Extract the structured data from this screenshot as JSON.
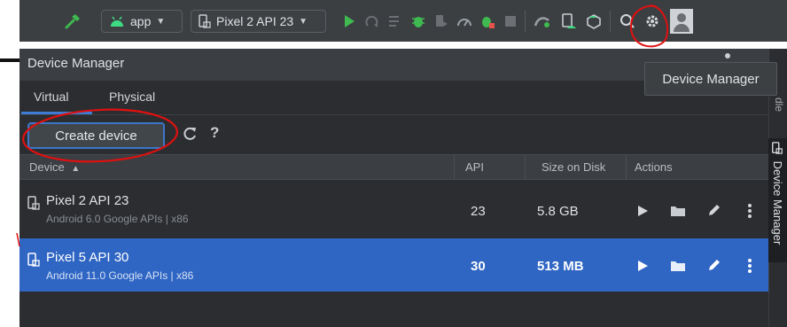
{
  "toolbar": {
    "run_config": "app",
    "device_selector": "Pixel 2 API 23"
  },
  "tooltip": {
    "text": "Device Manager"
  },
  "panel": {
    "title": "Device Manager",
    "tabs": [
      {
        "label": "Virtual",
        "active": true
      },
      {
        "label": "Physical",
        "active": false
      }
    ],
    "create_device_label": "Create device",
    "help_label": "?"
  },
  "table": {
    "columns": [
      "Device",
      "API",
      "Size on Disk",
      "Actions"
    ],
    "sort_column": "Device",
    "sort_direction": "ascending",
    "rows": [
      {
        "name": "Pixel 2 API 23",
        "subtitle": "Android 6.0 Google APIs | x86",
        "api": "23",
        "size": "5.8 GB",
        "selected": false
      },
      {
        "name": "Pixel 5 API 30",
        "subtitle": "Android 11.0 Google APIs | x86",
        "api": "30",
        "size": "513 MB",
        "selected": true
      }
    ]
  },
  "side_strip": {
    "device_manager_label": "Device Manager",
    "partial_label": "dle"
  },
  "colors": {
    "selection": "#2f65c3",
    "annotation": "#e01010",
    "android_green": "#3ddc84",
    "run_green": "#3fb950"
  },
  "icons": [
    "build-hammer-icon",
    "android-icon",
    "device-icon",
    "run-icon",
    "apply-changes-icon",
    "debug-icon",
    "profiler-icon",
    "stop-icon",
    "sync-icon",
    "device-manager-icon",
    "sdk-manager-icon",
    "search-icon",
    "settings-icon",
    "refresh-icon",
    "play-icon",
    "folder-icon",
    "edit-icon",
    "more-icon"
  ]
}
